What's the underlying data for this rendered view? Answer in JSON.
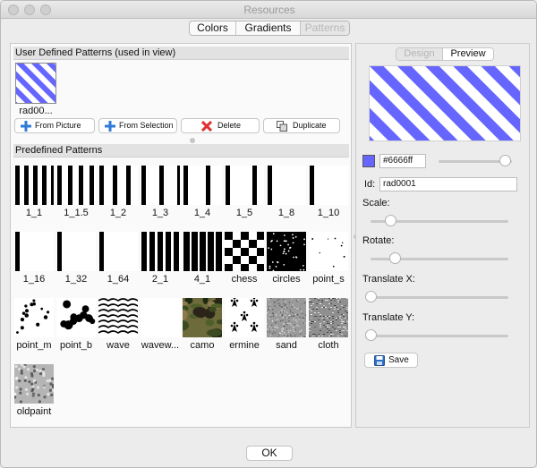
{
  "window": {
    "title": "Resources"
  },
  "top_tabs": [
    {
      "label": "Colors",
      "selected": false
    },
    {
      "label": "Gradients",
      "selected": false
    },
    {
      "label": "Patterns",
      "selected": true
    }
  ],
  "user_defined": {
    "header": "User Defined Patterns (used in view)",
    "items": [
      {
        "label": "rad00...",
        "pattern": "stripes-blue"
      }
    ],
    "buttons": {
      "from_picture": "From Picture",
      "from_selection": "From Selection",
      "delete": "Delete",
      "duplicate": "Duplicate"
    }
  },
  "predefined": {
    "header": "Predefined Patterns",
    "items": [
      {
        "label": "1_1",
        "pattern": "vbars-1-1"
      },
      {
        "label": "1_1.5",
        "pattern": "vbars-1-1.5"
      },
      {
        "label": "1_2",
        "pattern": "vbars-1-2"
      },
      {
        "label": "1_3",
        "pattern": "vbars-1-3"
      },
      {
        "label": "1_4",
        "pattern": "vbars-1-4"
      },
      {
        "label": "1_5",
        "pattern": "vbars-1-5"
      },
      {
        "label": "1_8",
        "pattern": "vbars-1-8"
      },
      {
        "label": "1_10",
        "pattern": "vbars-1-10"
      },
      {
        "label": "1_16",
        "pattern": "vbars-1-16"
      },
      {
        "label": "1_32",
        "pattern": "vbars-1-32"
      },
      {
        "label": "1_64",
        "pattern": "vbars-1-64"
      },
      {
        "label": "2_1",
        "pattern": "vbars-2-1"
      },
      {
        "label": "4_1",
        "pattern": "vbars-4-1"
      },
      {
        "label": "chess",
        "pattern": "chess"
      },
      {
        "label": "circles",
        "pattern": "circles"
      },
      {
        "label": "point_s",
        "pattern": "point-small"
      },
      {
        "label": "point_m",
        "pattern": "point-medium"
      },
      {
        "label": "point_b",
        "pattern": "point-big"
      },
      {
        "label": "wave",
        "pattern": "wave"
      },
      {
        "label": "wavew...",
        "pattern": "wave-wide"
      },
      {
        "label": "camo",
        "pattern": "camo"
      },
      {
        "label": "ermine",
        "pattern": "ermine"
      },
      {
        "label": "sand",
        "pattern": "sand"
      },
      {
        "label": "cloth",
        "pattern": "cloth"
      },
      {
        "label": "oldpaint",
        "pattern": "oldpaint"
      }
    ]
  },
  "editor": {
    "tabs": [
      {
        "label": "Design",
        "selected": false
      },
      {
        "label": "Preview",
        "selected": true
      }
    ],
    "color": "#6666ff",
    "color_hex": "#6666ff",
    "id_label": "Id:",
    "id_value": "rad0001",
    "scale_label": "Scale:",
    "rotate_label": "Rotate:",
    "translate_x_label": "Translate X:",
    "translate_y_label": "Translate Y:",
    "levels": {
      "color": 0.98,
      "scale": 0.15,
      "rotate": 0.18,
      "translate_x": 0.0,
      "translate_y": 0.0
    },
    "save_label": "Save"
  },
  "ok_label": "OK",
  "icons": {
    "from_picture": "plus-icon",
    "from_selection": "plus-icon",
    "delete": "red-x-icon",
    "duplicate": "duplicate-icon",
    "save": "floppy-disk-icon"
  },
  "colors": {
    "stripe": "#6666ff",
    "delete": "#e03030",
    "plus": "#2f7ad6"
  }
}
